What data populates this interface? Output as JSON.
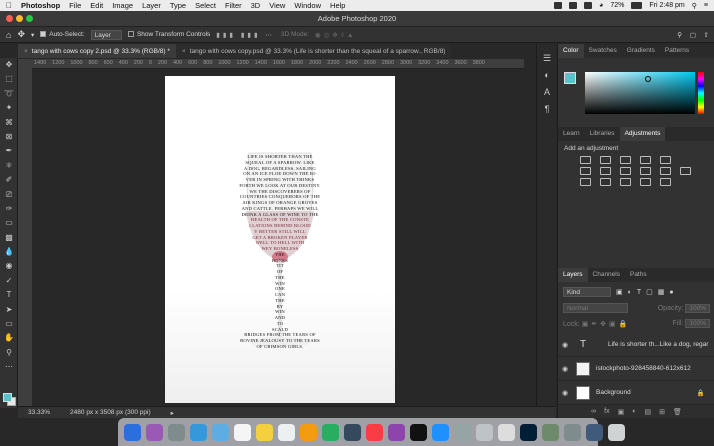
{
  "menubar": {
    "app": "Photoshop",
    "items": [
      "File",
      "Edit",
      "Image",
      "Layer",
      "Type",
      "Select",
      "Filter",
      "3D",
      "View",
      "Window",
      "Help"
    ],
    "battery": "72%",
    "clock": "Fri 2:48 pm"
  },
  "window": {
    "title": "Adobe Photoshop 2020"
  },
  "options": {
    "auto_select_label": "Auto-Select:",
    "auto_select_value": "Layer",
    "transform_label": "Show Transform Controls",
    "mode_label": "3D Mode:"
  },
  "tabs": [
    {
      "label": "tango with cows copy 2.psd @ 33.3% (RGB/8) *"
    },
    {
      "label": "tango with cows copy.psd @ 33.3% (Life is shorter than the squeal of a sparrow., RGB/8)"
    }
  ],
  "ruler": {
    "labels": "1400 1200 1000 800 600 400 200 0 200 400 600 800 1000 1200 1400 1600 1800 2000 2200 2400 2600 2800 3000 3200 3400 3600 3800"
  },
  "canvas": {
    "poem_lines": [
      "LIFE IS SHORTER THAN THE",
      "SQUEAL OF A SPARROW. LIKE",
      "A DOG, REGARDLESS, SAILING",
      "ON AN ICE FLOE DOWN THE RI-",
      "VER IN SPRING WITH THINKS",
      "FORTH WE LOOK AT OUR DESTINY.",
      "WE     THE DISCOVERERS     OF",
      "COUNTRIES CONQUERORS OF THE",
      "AIR  KINGS  OF  ORANGE  GROVES",
      "AND CATTLE. PERHAPS WE WILL",
      "DRINK A GLASS OF WINE TO THE",
      "HEALTH  OF  THE   CONSTE",
      "LLATIONS  BEHIND  BLOOD",
      "Y  BETTER  STILL  WILL",
      "GET  A  BROKEN  PLAYER",
      "WELL  TO  HELL  WITH",
      "WEY  BONELESS",
      "THE",
      "BONES",
      "TIT",
      "OF",
      "THE",
      "WIN",
      "ONE",
      "CAN",
      "THE",
      "BY",
      "WIN",
      "AND",
      "TO",
      "SCALD",
      "BRIDGES FROM THE TEARS OF",
      "BOVINE JEALOUSY TO THE TEARS",
      "OF CRIMSON GIRLS."
    ]
  },
  "status": {
    "zoom": "33.33%",
    "doc_info": "2480 px x 3508 px (300 ppi)"
  },
  "panels": {
    "color_tabs": [
      "Color",
      "Swatches",
      "Gradients",
      "Patterns"
    ],
    "adjust_tabs": [
      "Learn",
      "Libraries",
      "Adjustments"
    ],
    "adjust_hint": "Add an adjustment",
    "layers_tabs": [
      "Layers",
      "Channels",
      "Paths"
    ],
    "kind_label": "Kind",
    "blend_mode": "Normal",
    "opacity_label": "Opacity:",
    "opacity_value": "100%",
    "lock_label": "Lock:",
    "fill_label": "Fill:",
    "fill_value": "100%",
    "layers": [
      {
        "name": "Life is shorter th...Like a dog, regar",
        "type": "text"
      },
      {
        "name": "istockphoto-928458840-612x612",
        "type": "image"
      },
      {
        "name": "Background",
        "type": "background"
      }
    ]
  },
  "colors": {
    "accent": "#5bc1cc",
    "wine": "#c9344e"
  }
}
